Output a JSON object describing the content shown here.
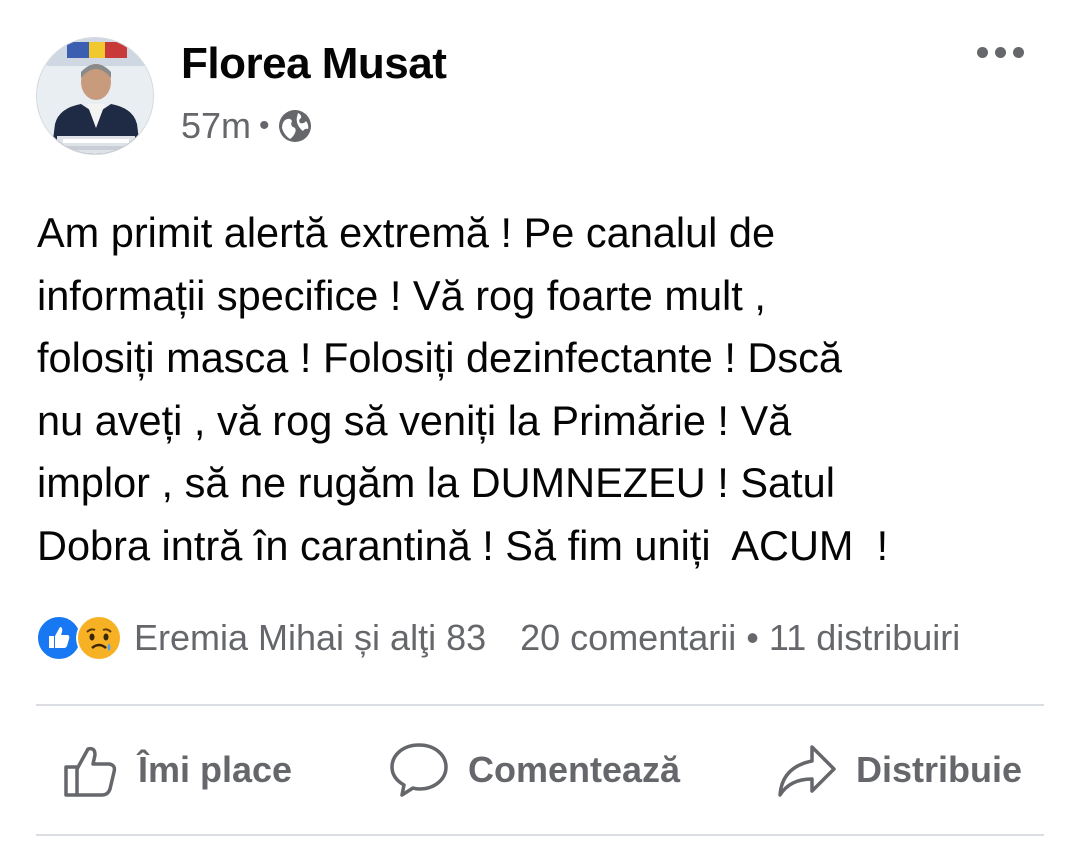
{
  "post": {
    "author": "Florea Musat",
    "time": "57m",
    "separator": "•",
    "audience_icon": "globe-icon",
    "more_icon": "more-options-icon",
    "text": "Am primit alertă extremă ! Pe canalul de\ninformații specifice ! Vă rog foarte mult ,\nfolosiți masca ! Folosiți dezinfectante ! Dscă\nnu aveți , vă rog să veniți la Primărie ! Vă\nimplor , să ne rugăm la DUMNEZEU ! Satul\nDobra intră în carantină ! Să fim uniți  ACUM  !"
  },
  "stats": {
    "reaction_icons": [
      "like-reaction-icon",
      "sad-reaction-icon"
    ],
    "reactors": "Eremia Mihai și alţi 83",
    "comments": "20 comentarii",
    "separator": "•",
    "shares": "11 distribuiri"
  },
  "actions": {
    "like_label": "Îmi place",
    "comment_label": "Comentează",
    "share_label": "Distribuie"
  },
  "colors": {
    "text": "#050505",
    "secondary": "#65676b",
    "divider": "#dadde1",
    "like_blue": "#1877f2",
    "sad_yellow": "#f7b125"
  }
}
